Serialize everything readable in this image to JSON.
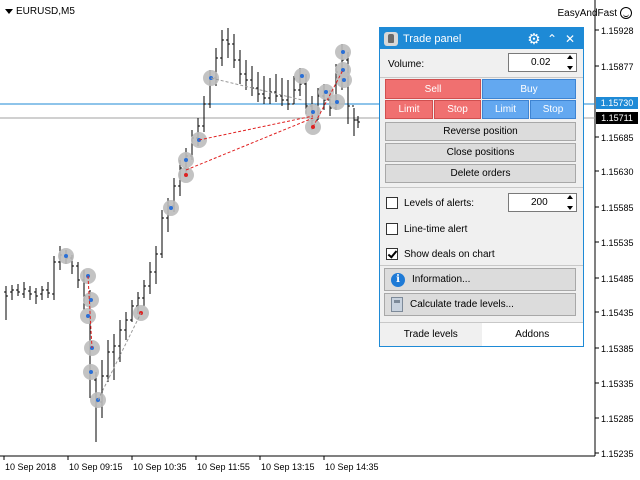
{
  "symbol": "EURUSD,M5",
  "brand": "EasyAndFast",
  "panel": {
    "title": "Trade panel",
    "volume_label": "Volume:",
    "volume_value": "0.02",
    "sell_label": "Sell",
    "buy_label": "Buy",
    "sell_limit": "Limit",
    "sell_stop": "Stop",
    "buy_limit": "Limit",
    "buy_stop": "Stop",
    "reverse_label": "Reverse position",
    "close_label": "Close positions",
    "delete_label": "Delete orders",
    "levels_alerts_label": "Levels of alerts:",
    "levels_alerts_value": "200",
    "levels_alerts_checked": false,
    "line_time_label": "Line-time alert",
    "line_time_checked": false,
    "show_deals_label": "Show deals on chart",
    "show_deals_checked": true,
    "information_label": "Information...",
    "calculate_label": "Calculate trade levels...",
    "tabs": [
      {
        "label": "Trade levels",
        "active": true
      },
      {
        "label": "Addons",
        "active": false
      }
    ]
  },
  "price_axis": [
    "1.15928",
    "1.15877",
    "1.15730",
    "1.15711",
    "1.15685",
    "1.15630",
    "1.15585",
    "1.15535",
    "1.15485",
    "1.15435",
    "1.15385",
    "1.15335",
    "1.15285",
    "1.15235"
  ],
  "price_axis_display": {
    "1.15928": "1.15928",
    "1.15877": "1.15877",
    "1.15730": "1.15730",
    "1.15711": "1.15711",
    "1.15685": "1.15685",
    "1.15630": "1.15630",
    "1.15585": "1.15585",
    "1.15535": "1.15535",
    "1.15485": "1.15485",
    "1.15435": "1.15435",
    "1.15385": "1.15385",
    "1.15335": "1.15335",
    "1.15285": "1.15285",
    "1.15235": "1.15235"
  },
  "time_axis": [
    "10 Sep 2018",
    "10 Sep 09:15",
    "10 Sep 10:35",
    "10 Sep 11:55",
    "10 Sep 13:15",
    "10 Sep 14:35"
  ],
  "current_price_bid": "1.15730",
  "current_price_last": "1.15711",
  "colors": {
    "panel_accent": "#1e8ad6",
    "sell": "#f07070",
    "buy": "#63a8f0",
    "bid_line": "#1e8ad6"
  }
}
